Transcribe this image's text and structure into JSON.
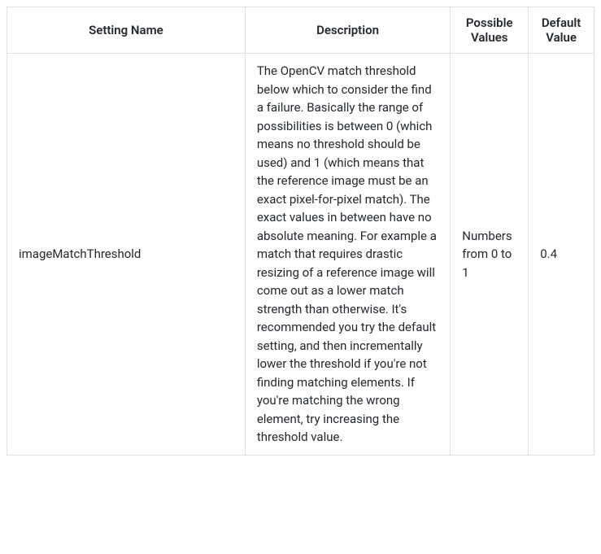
{
  "headers": {
    "name": "Setting Name",
    "description": "Description",
    "possible": "Possible Values",
    "default": "Default Value"
  },
  "rows": [
    {
      "name": "imageMatchThreshold",
      "description": "The OpenCV match threshold below which to consider the find a failure. Basically the range of possibilities is between 0 (which means no threshold should be used) and 1 (which means that the reference image must be an exact pixel-for-pixel match). The exact values in between have no absolute meaning. For example a match that requires drastic resizing of a reference image will come out as a lower match strength than otherwise. It's recommended you try the default setting, and then incrementally lower the threshold if you're not finding matching elements. If you're matching the wrong element, try increasing the threshold value.",
      "possible": "Numbers from 0 to 1",
      "default": "0.4"
    }
  ]
}
